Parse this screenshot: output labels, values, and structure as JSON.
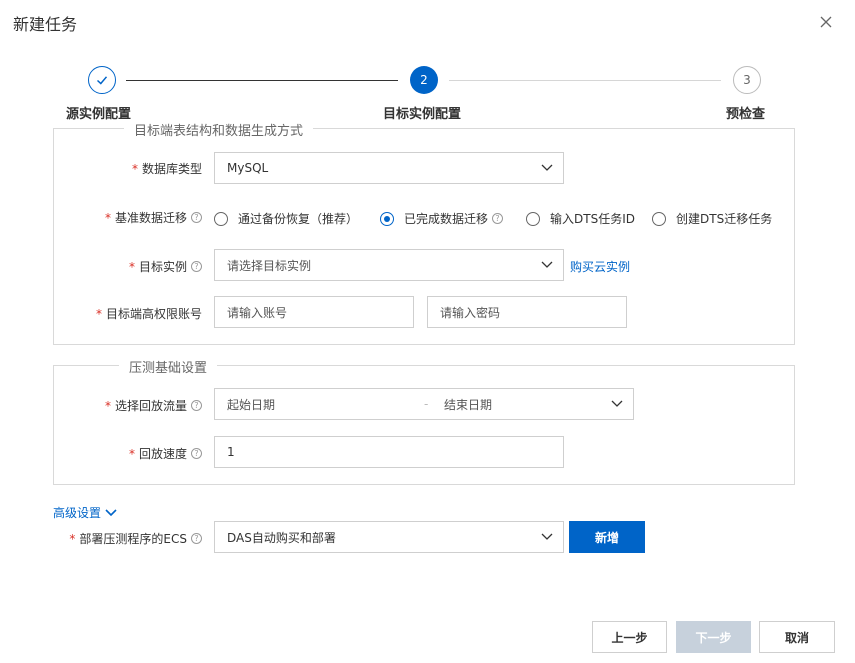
{
  "dialog": {
    "title": "新建任务"
  },
  "steps": [
    {
      "number": "",
      "label": "源实例配置",
      "state": "done"
    },
    {
      "number": "2",
      "label": "目标实例配置",
      "state": "active"
    },
    {
      "number": "3",
      "label": "预检查",
      "state": "todo"
    }
  ],
  "target_section": {
    "legend": "目标端表结构和数据生成方式",
    "db_type": {
      "label": "数据库类型",
      "value": "MySQL"
    },
    "baseline": {
      "label": "基准数据迁移",
      "options": [
        {
          "label": "通过备份恢复（推荐）",
          "checked": false
        },
        {
          "label": "已完成数据迁移",
          "checked": true
        },
        {
          "label": "输入DTS任务ID",
          "checked": false
        },
        {
          "label": "创建DTS迁移任务",
          "checked": false
        }
      ]
    },
    "target_instance": {
      "label": "目标实例",
      "placeholder": "请选择目标实例",
      "link": "购买云实例"
    },
    "account": {
      "label": "目标端高权限账号",
      "account_placeholder": "请输入账号",
      "password_placeholder": "请输入密码"
    }
  },
  "pressure_section": {
    "legend": "压测基础设置",
    "traffic": {
      "label": "选择回放流量",
      "start_placeholder": "起始日期",
      "separator": "-",
      "end_placeholder": "结束日期"
    },
    "speed": {
      "label": "回放速度",
      "value": "1"
    }
  },
  "advanced": {
    "toggle_label": "高级设置",
    "ecs": {
      "label": "部署压测程序的ECS",
      "value": "DAS自动购买和部署",
      "add_button": "新增"
    }
  },
  "footer": {
    "prev": "上一步",
    "next": "下一步",
    "cancel": "取消"
  },
  "colors": {
    "primary": "#0064c8",
    "required": "#d93026",
    "disabled": "#c7d1dc"
  },
  "required_mark": "*",
  "help_glyph": "?"
}
